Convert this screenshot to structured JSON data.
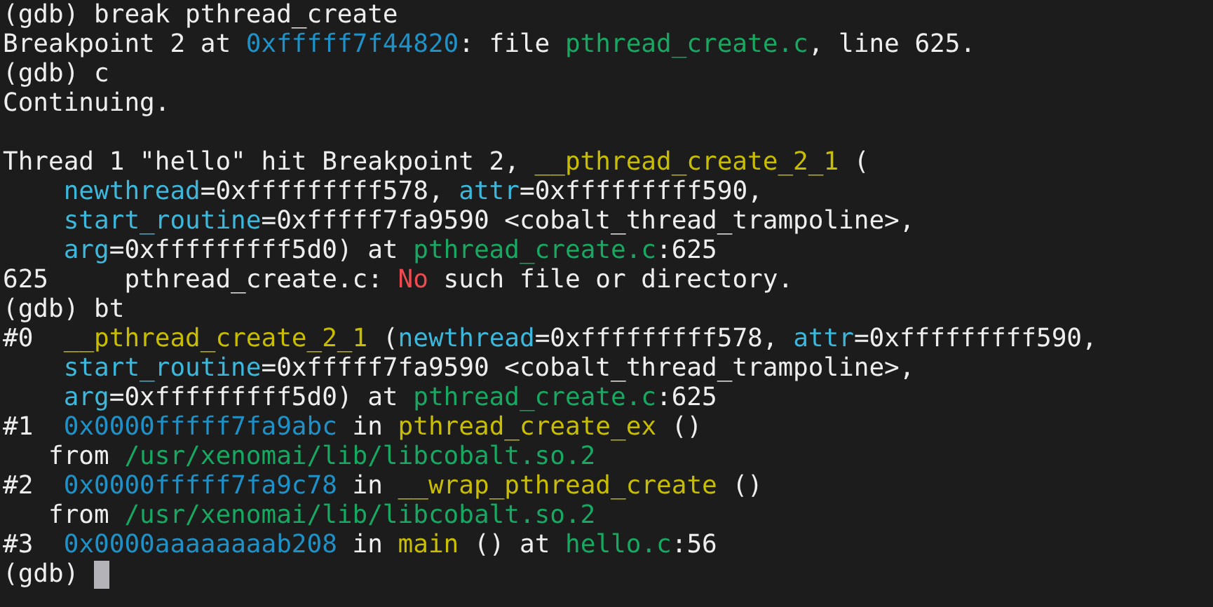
{
  "terminal": {
    "cursor": true,
    "lines": [
      {
        "segments": [
          {
            "kind": "plain",
            "text": "(gdb) break pthread_create"
          }
        ]
      },
      {
        "segments": [
          {
            "kind": "plain",
            "text": "Breakpoint 2 at "
          },
          {
            "kind": "address",
            "text": "0xfffff7f44820"
          },
          {
            "kind": "plain",
            "text": ": file "
          },
          {
            "kind": "file",
            "text": "pthread_create.c"
          },
          {
            "kind": "plain",
            "text": ", line 625."
          }
        ]
      },
      {
        "segments": [
          {
            "kind": "plain",
            "text": "(gdb) c"
          }
        ]
      },
      {
        "segments": [
          {
            "kind": "plain",
            "text": "Continuing."
          }
        ]
      },
      {
        "gap_before": true,
        "segments": [
          {
            "kind": "plain",
            "text": "Thread 1 \"hello\" hit Breakpoint 2, "
          },
          {
            "kind": "function",
            "text": "__pthread_create_2_1"
          },
          {
            "kind": "plain",
            "text": " ("
          }
        ]
      },
      {
        "indented": true,
        "segments": [
          {
            "kind": "param",
            "text": "newthread"
          },
          {
            "kind": "plain",
            "text": "=0xfffffffff578, "
          },
          {
            "kind": "param",
            "text": "attr"
          },
          {
            "kind": "plain",
            "text": "=0xfffffffff590,"
          }
        ]
      },
      {
        "indented": true,
        "segments": [
          {
            "kind": "param",
            "text": "start_routine"
          },
          {
            "kind": "plain",
            "text": "=0xfffff7fa9590 <cobalt_thread_trampoline>,"
          }
        ]
      },
      {
        "indented": true,
        "segments": [
          {
            "kind": "param",
            "text": "arg"
          },
          {
            "kind": "plain",
            "text": "=0xfffffffff5d0) at "
          },
          {
            "kind": "file",
            "text": "pthread_create.c"
          },
          {
            "kind": "plain",
            "text": ":625"
          }
        ]
      },
      {
        "segments": [
          {
            "kind": "plain",
            "text": "625     pthread_create.c: "
          },
          {
            "kind": "error",
            "text": "No"
          },
          {
            "kind": "plain",
            "text": " such file or directory."
          }
        ]
      },
      {
        "segments": [
          {
            "kind": "plain",
            "text": "(gdb) bt"
          }
        ]
      },
      {
        "segments": [
          {
            "kind": "plain",
            "text": "#0  "
          },
          {
            "kind": "function",
            "text": "__pthread_create_2_1"
          },
          {
            "kind": "plain",
            "text": " ("
          },
          {
            "kind": "param",
            "text": "newthread"
          },
          {
            "kind": "plain",
            "text": "=0xfffffffff578, "
          },
          {
            "kind": "param",
            "text": "attr"
          },
          {
            "kind": "plain",
            "text": "=0xfffffffff590,"
          }
        ]
      },
      {
        "indented": true,
        "segments": [
          {
            "kind": "param",
            "text": "start_routine"
          },
          {
            "kind": "plain",
            "text": "=0xfffff7fa9590 <cobalt_thread_trampoline>,"
          }
        ]
      },
      {
        "indented": true,
        "segments": [
          {
            "kind": "param",
            "text": "arg"
          },
          {
            "kind": "plain",
            "text": "=0xfffffffff5d0) at "
          },
          {
            "kind": "file",
            "text": "pthread_create.c"
          },
          {
            "kind": "plain",
            "text": ":625"
          }
        ]
      },
      {
        "segments": [
          {
            "kind": "plain",
            "text": "#1  "
          },
          {
            "kind": "address",
            "text": "0x0000fffff7fa9abc"
          },
          {
            "kind": "plain",
            "text": " in "
          },
          {
            "kind": "function",
            "text": "pthread_create_ex"
          },
          {
            "kind": "plain",
            "text": " ()"
          }
        ]
      },
      {
        "segments": [
          {
            "kind": "plain",
            "text": "   from "
          },
          {
            "kind": "file",
            "text": "/usr/xenomai/lib/libcobalt.so.2"
          }
        ]
      },
      {
        "segments": [
          {
            "kind": "plain",
            "text": "#2  "
          },
          {
            "kind": "address",
            "text": "0x0000fffff7fa9c78"
          },
          {
            "kind": "plain",
            "text": " in "
          },
          {
            "kind": "function",
            "text": "__wrap_pthread_create"
          },
          {
            "kind": "plain",
            "text": " ()"
          }
        ]
      },
      {
        "segments": [
          {
            "kind": "plain",
            "text": "   from "
          },
          {
            "kind": "file",
            "text": "/usr/xenomai/lib/libcobalt.so.2"
          }
        ]
      },
      {
        "segments": [
          {
            "kind": "plain",
            "text": "#3  "
          },
          {
            "kind": "address",
            "text": "0x0000aaaaaaaab208"
          },
          {
            "kind": "plain",
            "text": " in "
          },
          {
            "kind": "function",
            "text": "main"
          },
          {
            "kind": "plain",
            "text": " () at "
          },
          {
            "kind": "file",
            "text": "hello.c"
          },
          {
            "kind": "plain",
            "text": ":56"
          }
        ]
      },
      {
        "segments": [
          {
            "kind": "plain",
            "text": "(gdb) "
          }
        ]
      }
    ]
  }
}
